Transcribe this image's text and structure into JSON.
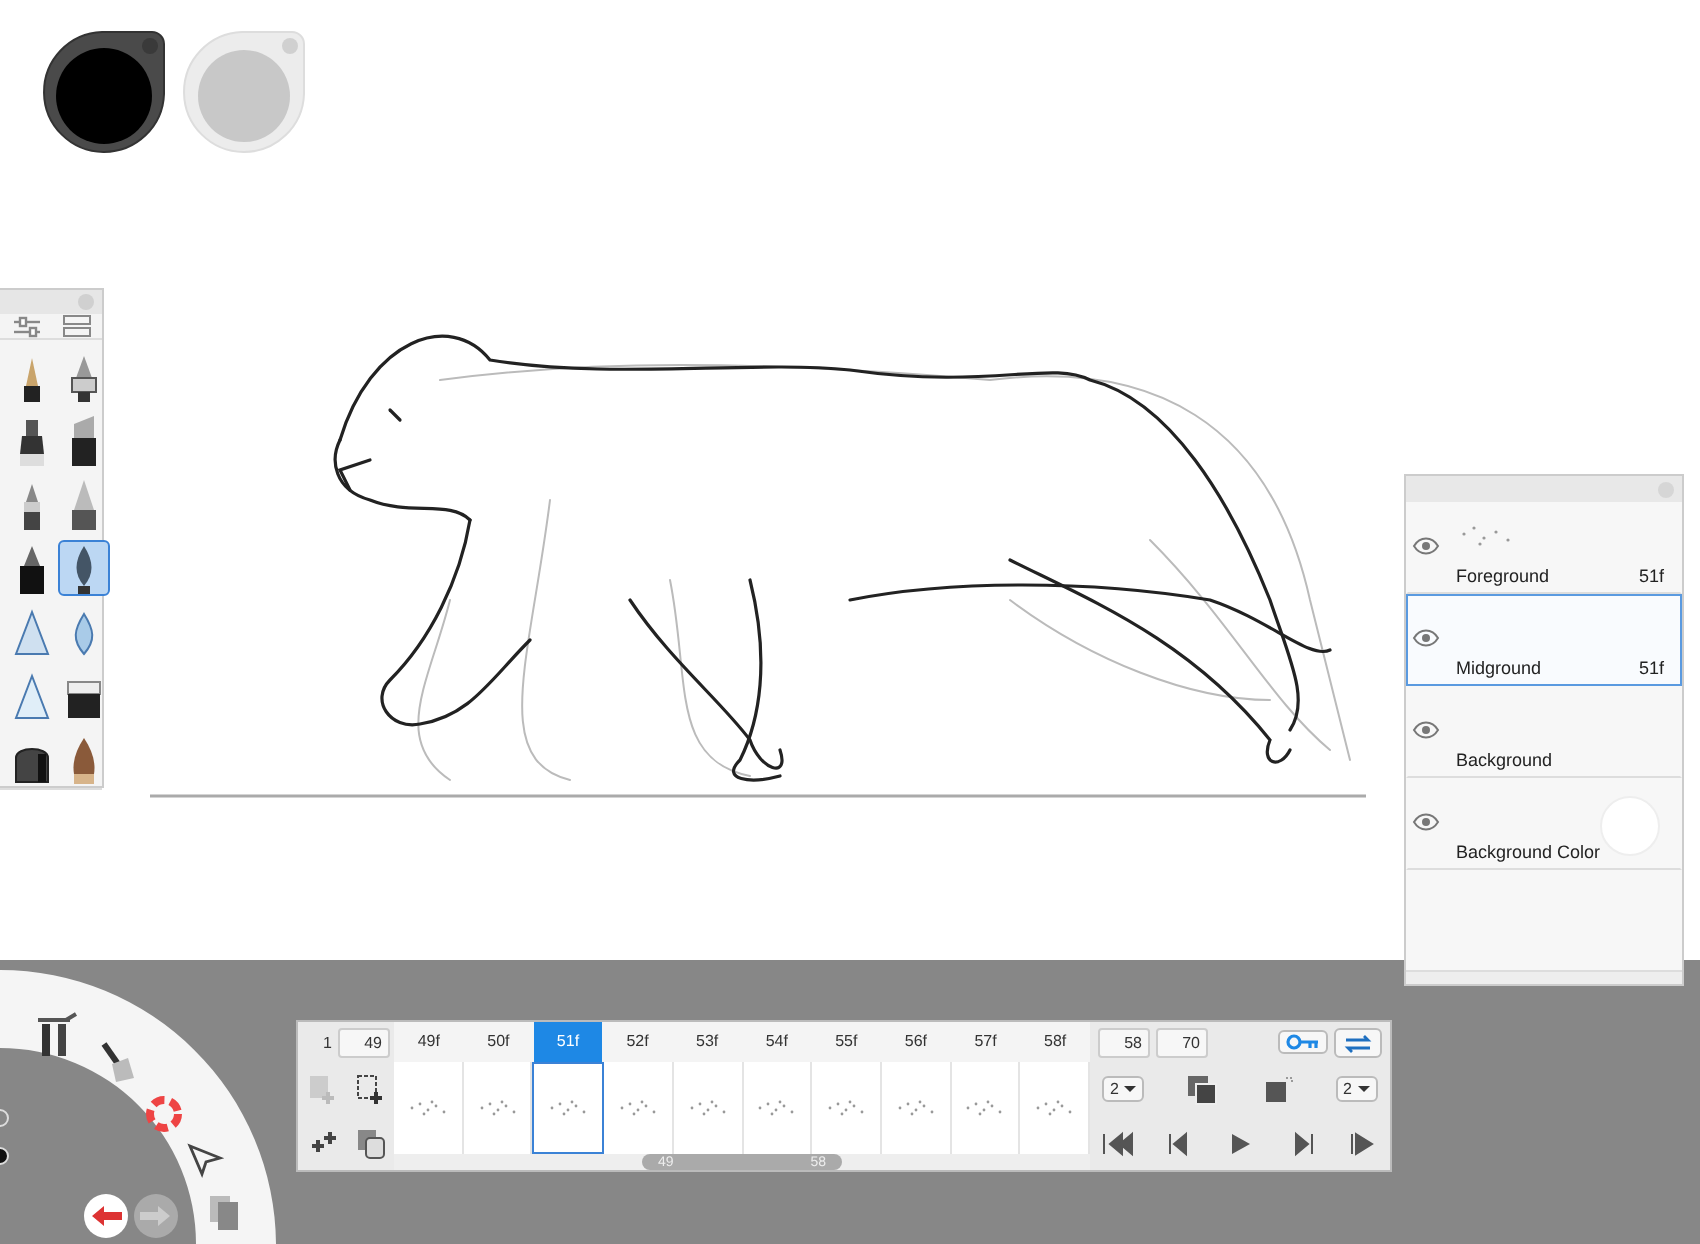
{
  "color_pucks": [
    {
      "color": "#000000",
      "selected": true
    },
    {
      "color": "#c8c8c8",
      "selected": false
    }
  ],
  "brush_palette": {
    "brushes": [
      {
        "selected": false
      },
      {
        "selected": false
      },
      {
        "selected": false
      },
      {
        "selected": false
      },
      {
        "selected": false
      },
      {
        "selected": false
      },
      {
        "selected": false
      },
      {
        "selected": true
      },
      {
        "selected": false
      },
      {
        "selected": false
      },
      {
        "selected": false
      },
      {
        "selected": false
      },
      {
        "selected": false
      },
      {
        "selected": false
      }
    ]
  },
  "layers": [
    {
      "kind": "layer",
      "name": "Foreground",
      "frames": "51f",
      "visible": true,
      "selected": false
    },
    {
      "kind": "layer",
      "name": "Midground",
      "frames": "51f",
      "visible": true,
      "selected": true
    },
    {
      "kind": "layer",
      "name": "Background",
      "visible": true,
      "selected": false
    },
    {
      "kind": "color",
      "name": "Background Color",
      "visible": true,
      "selected": false,
      "color": "#ffffff"
    }
  ],
  "timeline": {
    "first_frame": "1",
    "range_start": "49",
    "range_end": "58",
    "last_frame": "70",
    "onion_before": "2",
    "onion_after": "2",
    "scroll_start": "49",
    "scroll_end": "58",
    "frames": [
      {
        "label": "49f",
        "selected": false
      },
      {
        "label": "50f",
        "selected": false
      },
      {
        "label": "51f",
        "selected": true
      },
      {
        "label": "52f",
        "selected": false
      },
      {
        "label": "53f",
        "selected": false
      },
      {
        "label": "54f",
        "selected": false
      },
      {
        "label": "55f",
        "selected": false
      },
      {
        "label": "56f",
        "selected": false
      },
      {
        "label": "57f",
        "selected": false
      },
      {
        "label": "58f",
        "selected": false
      }
    ]
  }
}
